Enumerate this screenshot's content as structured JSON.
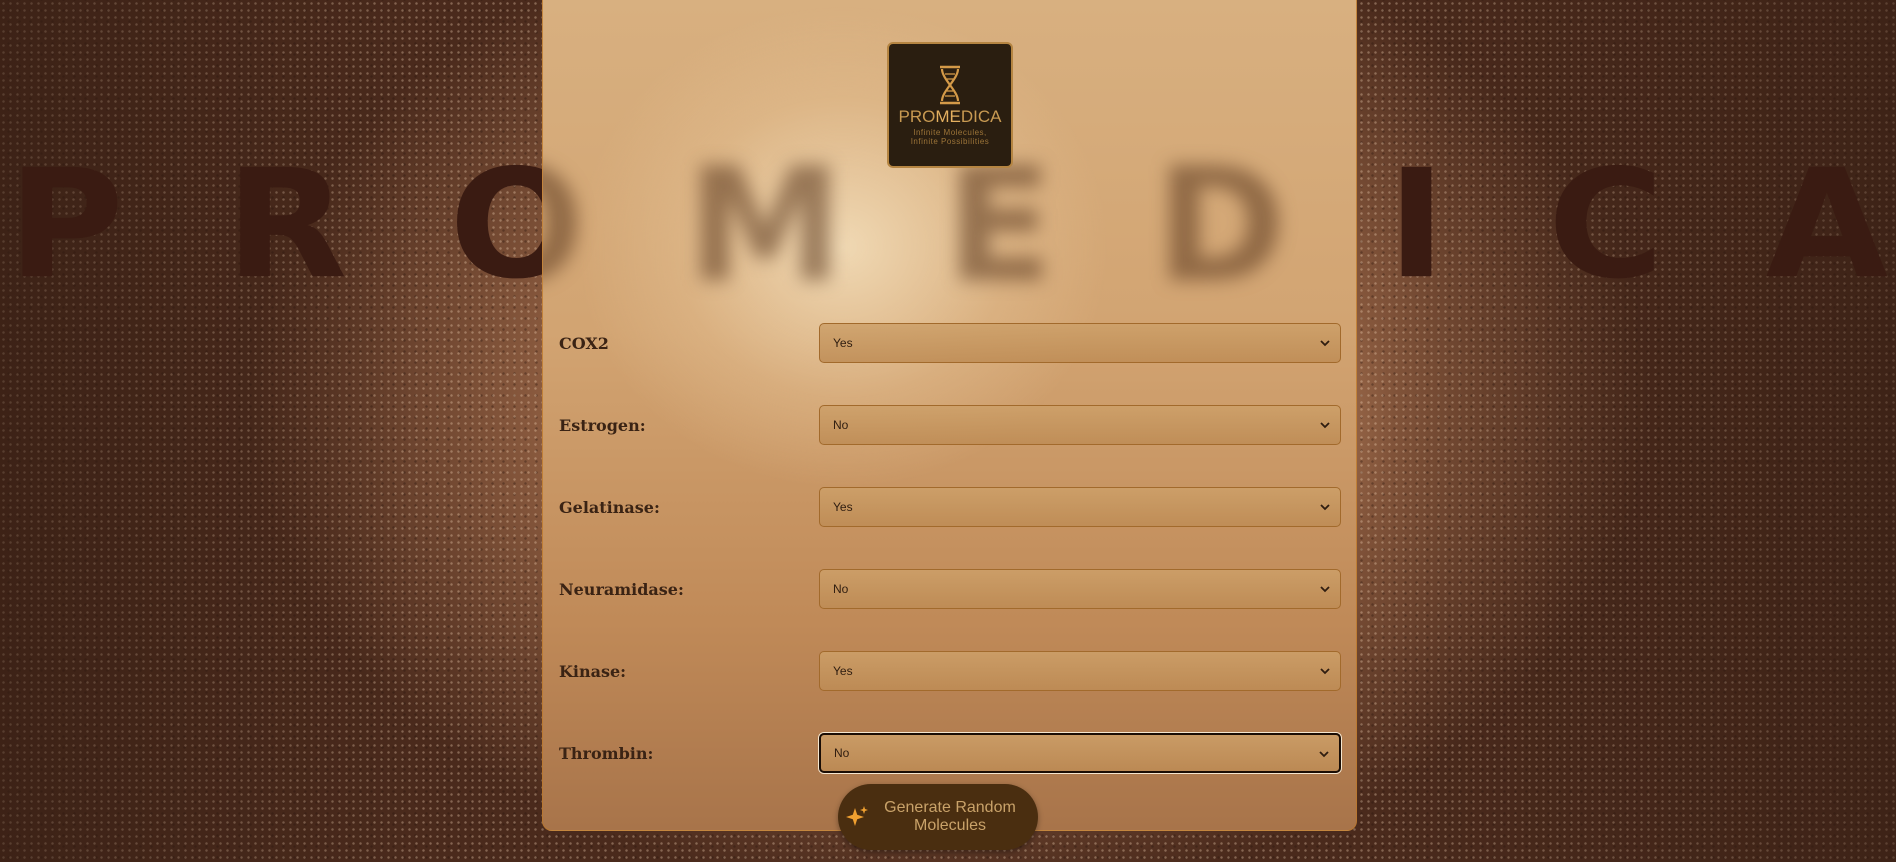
{
  "background": {
    "word_letters": [
      "P",
      "R",
      "O",
      "M",
      "E",
      "D",
      "I",
      "C",
      "A"
    ]
  },
  "logo": {
    "title_pre": "PRO",
    "title_hl": "ME",
    "title_post": "DICA",
    "tagline_1": "Infinite Molecules,",
    "tagline_2": "Infinite Possibilities"
  },
  "form": {
    "fields": [
      {
        "label": "COX2",
        "value": "Yes"
      },
      {
        "label": "Estrogen:",
        "value": "No"
      },
      {
        "label": "Gelatinase:",
        "value": "Yes"
      },
      {
        "label": "Neuramidase:",
        "value": "No"
      },
      {
        "label": "Kinase:",
        "value": "Yes"
      },
      {
        "label": "Thrombin:",
        "value": "No"
      }
    ]
  },
  "generate_button": {
    "label_line1": "Generate Random",
    "label_line2": "Molecules",
    "icon": "sparkle-icon"
  },
  "colors": {
    "brand_gold": "#c89a52",
    "button_bg": "#4a2e10",
    "select_border": "#a26a2c"
  }
}
